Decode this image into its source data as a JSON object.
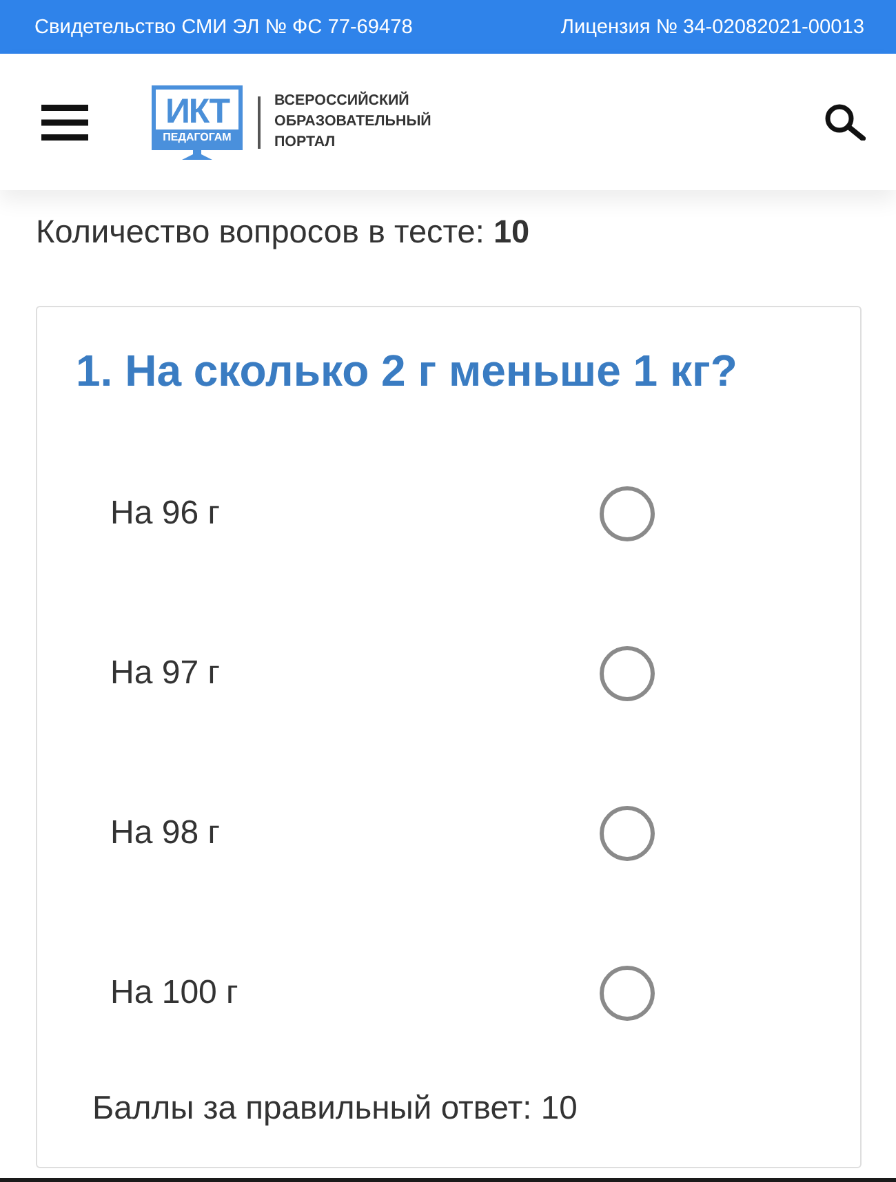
{
  "top_bar": {
    "left": "Свидетельство СМИ ЭЛ № ФС 77-69478",
    "right": "Лицензия № 34-02082021-00013"
  },
  "header": {
    "logo": {
      "mark": "ИКТ",
      "caption": "ПЕДАГОГАМ",
      "tagline": [
        "ВСЕРОССИЙСКИЙ",
        "ОБРАЗОВАТЕЛЬНЫЙ",
        "ПОРТАЛ"
      ]
    }
  },
  "question_count": "Количество вопросов в тесте: **10**",
  "question": {
    "title": "1. На сколько 2 г меньше 1 кг?",
    "options": [
      {
        "label": "На 96 г",
        "selected": false
      },
      {
        "label": "На 97 г",
        "selected": false
      },
      {
        "label": "На 98 г",
        "selected": false
      },
      {
        "label": "На 100 г",
        "selected": false
      }
    ],
    "points": "Баллы за правильный ответ: 10"
  }
}
